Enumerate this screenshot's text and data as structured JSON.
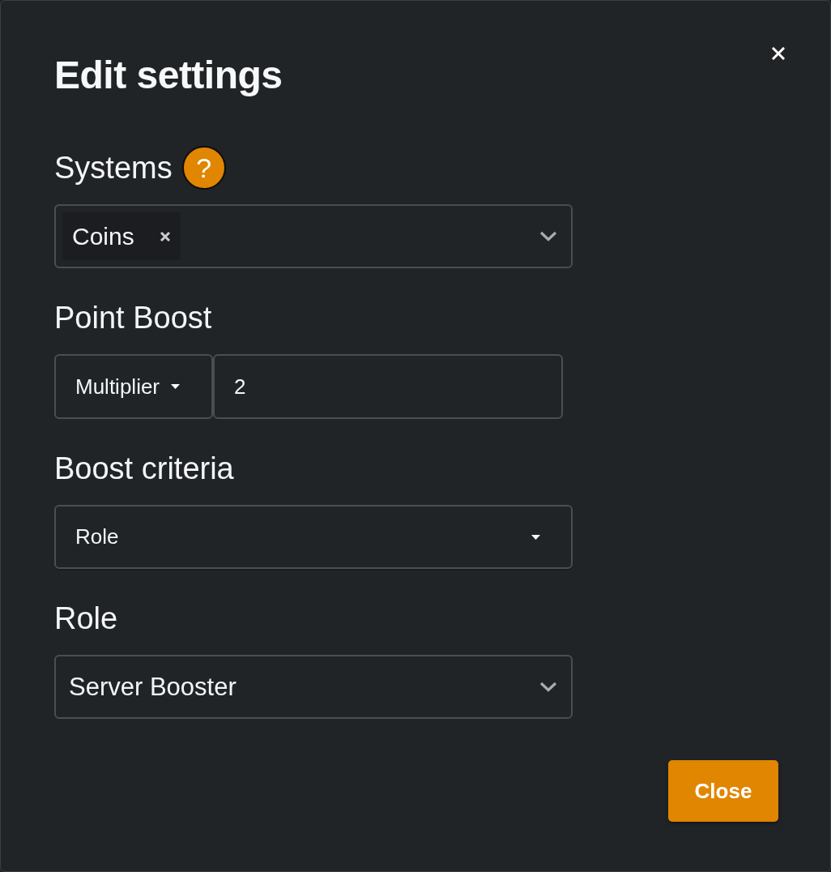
{
  "dialog": {
    "title": "Edit settings"
  },
  "fields": [
    {
      "kind": "tag_select",
      "label": "Systems",
      "help_badge": "?",
      "tags": [
        {
          "label": "Coins"
        }
      ]
    },
    {
      "kind": "input_group",
      "label": "Point Boost",
      "dropdown": "Multiplier",
      "value": "2"
    },
    {
      "kind": "native_select",
      "label": "Boost criteria",
      "value": "Role"
    },
    {
      "kind": "select",
      "label": "Role",
      "value": "Server Booster"
    }
  ],
  "buttons": [
    {
      "label": "Close",
      "kind": "primary"
    }
  ]
}
